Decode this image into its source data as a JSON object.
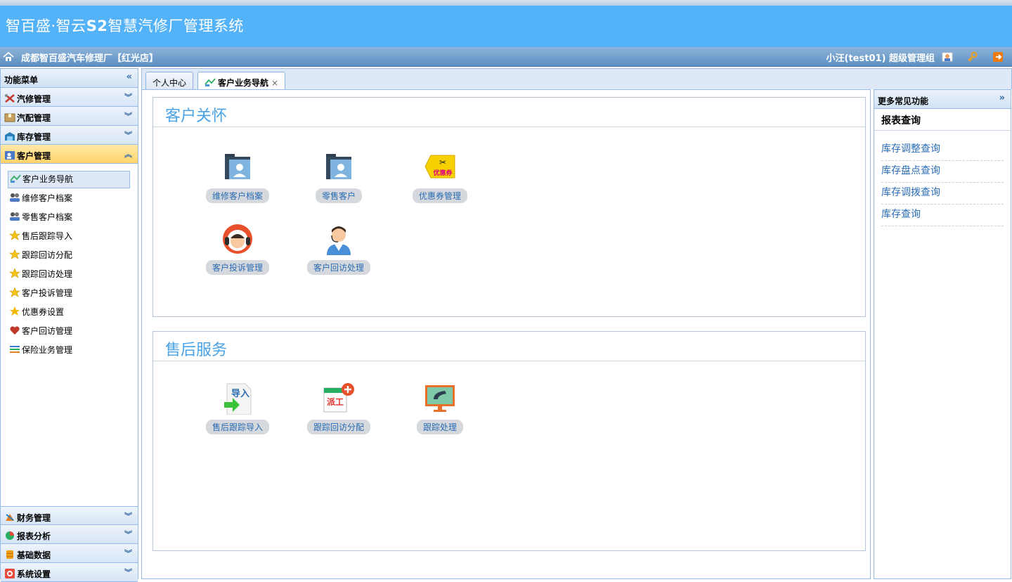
{
  "header": {
    "app_title_prefix": "智百盛·智云",
    "app_title_brand": "S2",
    "app_title_suffix": "智慧汽修厂管理系统",
    "shop_name": "成都智百盛汽车修理厂【红光店】",
    "user_info": "小汪(test01)  超级管理组"
  },
  "sidebar": {
    "title": "功能菜单",
    "sections_top": [
      {
        "label": "汽修管理",
        "icon": "tools-icon"
      },
      {
        "label": "汽配管理",
        "icon": "box-icon"
      },
      {
        "label": "库存管理",
        "icon": "warehouse-icon"
      },
      {
        "label": "客户管理",
        "icon": "customer-card-icon"
      }
    ],
    "items": [
      {
        "label": "客户业务导航",
        "icon": "map-icon"
      },
      {
        "label": "维修客户档案",
        "icon": "users-icon"
      },
      {
        "label": "零售客户档案",
        "icon": "users-icon"
      },
      {
        "label": "售后跟踪导入",
        "icon": "half-star-icon"
      },
      {
        "label": "跟踪回访分配",
        "icon": "half-star-icon"
      },
      {
        "label": "跟踪回访处理",
        "icon": "half-star-icon"
      },
      {
        "label": "客户投诉管理",
        "icon": "half-star-icon"
      },
      {
        "label": "优惠券设置",
        "icon": "star-icon"
      },
      {
        "label": "客户回访管理",
        "icon": "heart-icon"
      },
      {
        "label": "保险业务管理",
        "icon": "sliders-icon"
      }
    ],
    "sections_bottom": [
      {
        "label": "财务管理",
        "icon": "finance-icon"
      },
      {
        "label": "报表分析",
        "icon": "pie-icon"
      },
      {
        "label": "基础数据",
        "icon": "database-icon"
      },
      {
        "label": "系统设置",
        "icon": "settings-icon"
      }
    ]
  },
  "tabs": [
    {
      "label": "个人中心"
    },
    {
      "label": "客户业务导航",
      "close": "×"
    }
  ],
  "panels": {
    "care": {
      "title": "客户关怀",
      "tiles": [
        "维修客户档案",
        "零售客户",
        "优惠券管理",
        "客户投诉管理",
        "客户回访处理"
      ]
    },
    "after_sales": {
      "title": "售后服务",
      "tiles": [
        "售后跟踪导入",
        "跟踪回访分配",
        "跟踪处理"
      ]
    }
  },
  "tile_icon_text": {
    "coupon": "优惠券",
    "import": "导入",
    "dispatch": "派工"
  },
  "right_panel": {
    "title": "更多常见功能",
    "subtitle": "报表查询",
    "links": [
      "库存调整查询",
      "库存盘点查询",
      "库存调拨查询",
      "库存查询"
    ]
  }
}
